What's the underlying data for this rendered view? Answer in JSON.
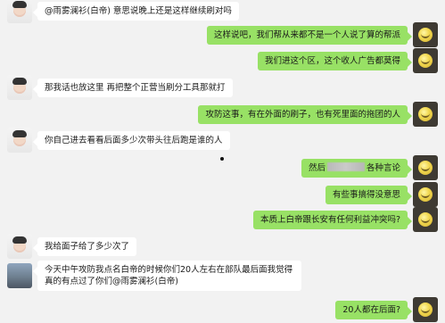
{
  "messages": [
    {
      "id": "m1",
      "side": "left",
      "avatar": "person-avatar",
      "text": "@雨雾澜衫(白帝) 意思说晚上还是这样继续刷对吗"
    },
    {
      "id": "m2",
      "side": "right",
      "avatar": "star-avatar",
      "text": "这样说吧，我们帮从来都不是一个人说了算的帮派"
    },
    {
      "id": "m3",
      "side": "right",
      "avatar": "star-avatar",
      "text": "我们进这个区，这个收人广告都莫得"
    },
    {
      "id": "m4",
      "side": "left",
      "avatar": "person-avatar",
      "text": "那我话也放这里  再把整个正营当刷分工具那就打"
    },
    {
      "id": "m5",
      "side": "right",
      "avatar": "star-avatar",
      "text": "攻防这事，有在外面的刷子，也有死里面的拖团的人"
    },
    {
      "id": "m6",
      "side": "left",
      "avatar": "person-avatar",
      "text": "你自己进去看看后面多少次带头往后跑是谁的人"
    },
    {
      "id": "m7",
      "side": "right",
      "avatar": "star-avatar",
      "text_prefix": "然后",
      "text_suffix": "各种言论"
    },
    {
      "id": "m8",
      "side": "right",
      "avatar": "star-avatar",
      "text": "有些事搞得没意思"
    },
    {
      "id": "m9",
      "side": "right",
      "avatar": "star-avatar",
      "text": "本质上白帝跟长安有任何利益冲突吗?"
    },
    {
      "id": "m10",
      "side": "left",
      "avatar": "person-avatar",
      "text": "我给面子给了多少次了"
    },
    {
      "id": "m11",
      "side": "left",
      "avatar": "landscape-avatar",
      "text": "今天中午攻防我点名白帝的时候你们20人左右在部队最后面我觉得真的有点过了你们@雨雾澜衫(白帝)"
    },
    {
      "id": "m12",
      "side": "right",
      "avatar": "star-avatar",
      "text": "20人都在后面?"
    }
  ]
}
